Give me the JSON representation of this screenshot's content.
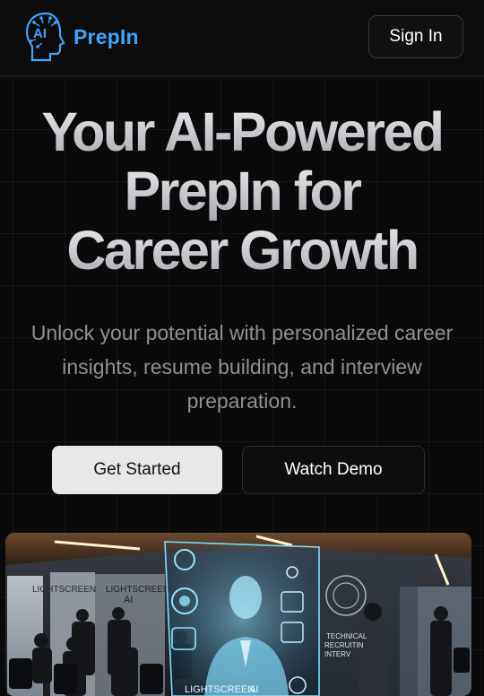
{
  "brand": {
    "name": "PrepIn",
    "mark_text": "AI"
  },
  "nav": {
    "signin_label": "Sign In"
  },
  "hero": {
    "title_lines": [
      "Your AI-Powered",
      "PrepIn for",
      "Career Growth"
    ],
    "subtitle": "Unlock your potential with personalized career insights, resume building, and interview preparation.",
    "primary_button": "Get Started",
    "secondary_button": "Watch Demo"
  },
  "hero_image": {
    "wall_text_1": "LIGHTSCREEN",
    "wall_text_2": "LIGHTSCREEN",
    "wall_text_3": "AI",
    "hologram_caption": "LIGHTSCREEN",
    "hologram_caption_suffix": "AI",
    "side_panel_lines": [
      "TECHNICAL",
      "RECRUITIN",
      "INTERV"
    ]
  },
  "colors": {
    "brand_blue": "#3ea6ff",
    "hologram_cyan": "#6fd8ff"
  }
}
